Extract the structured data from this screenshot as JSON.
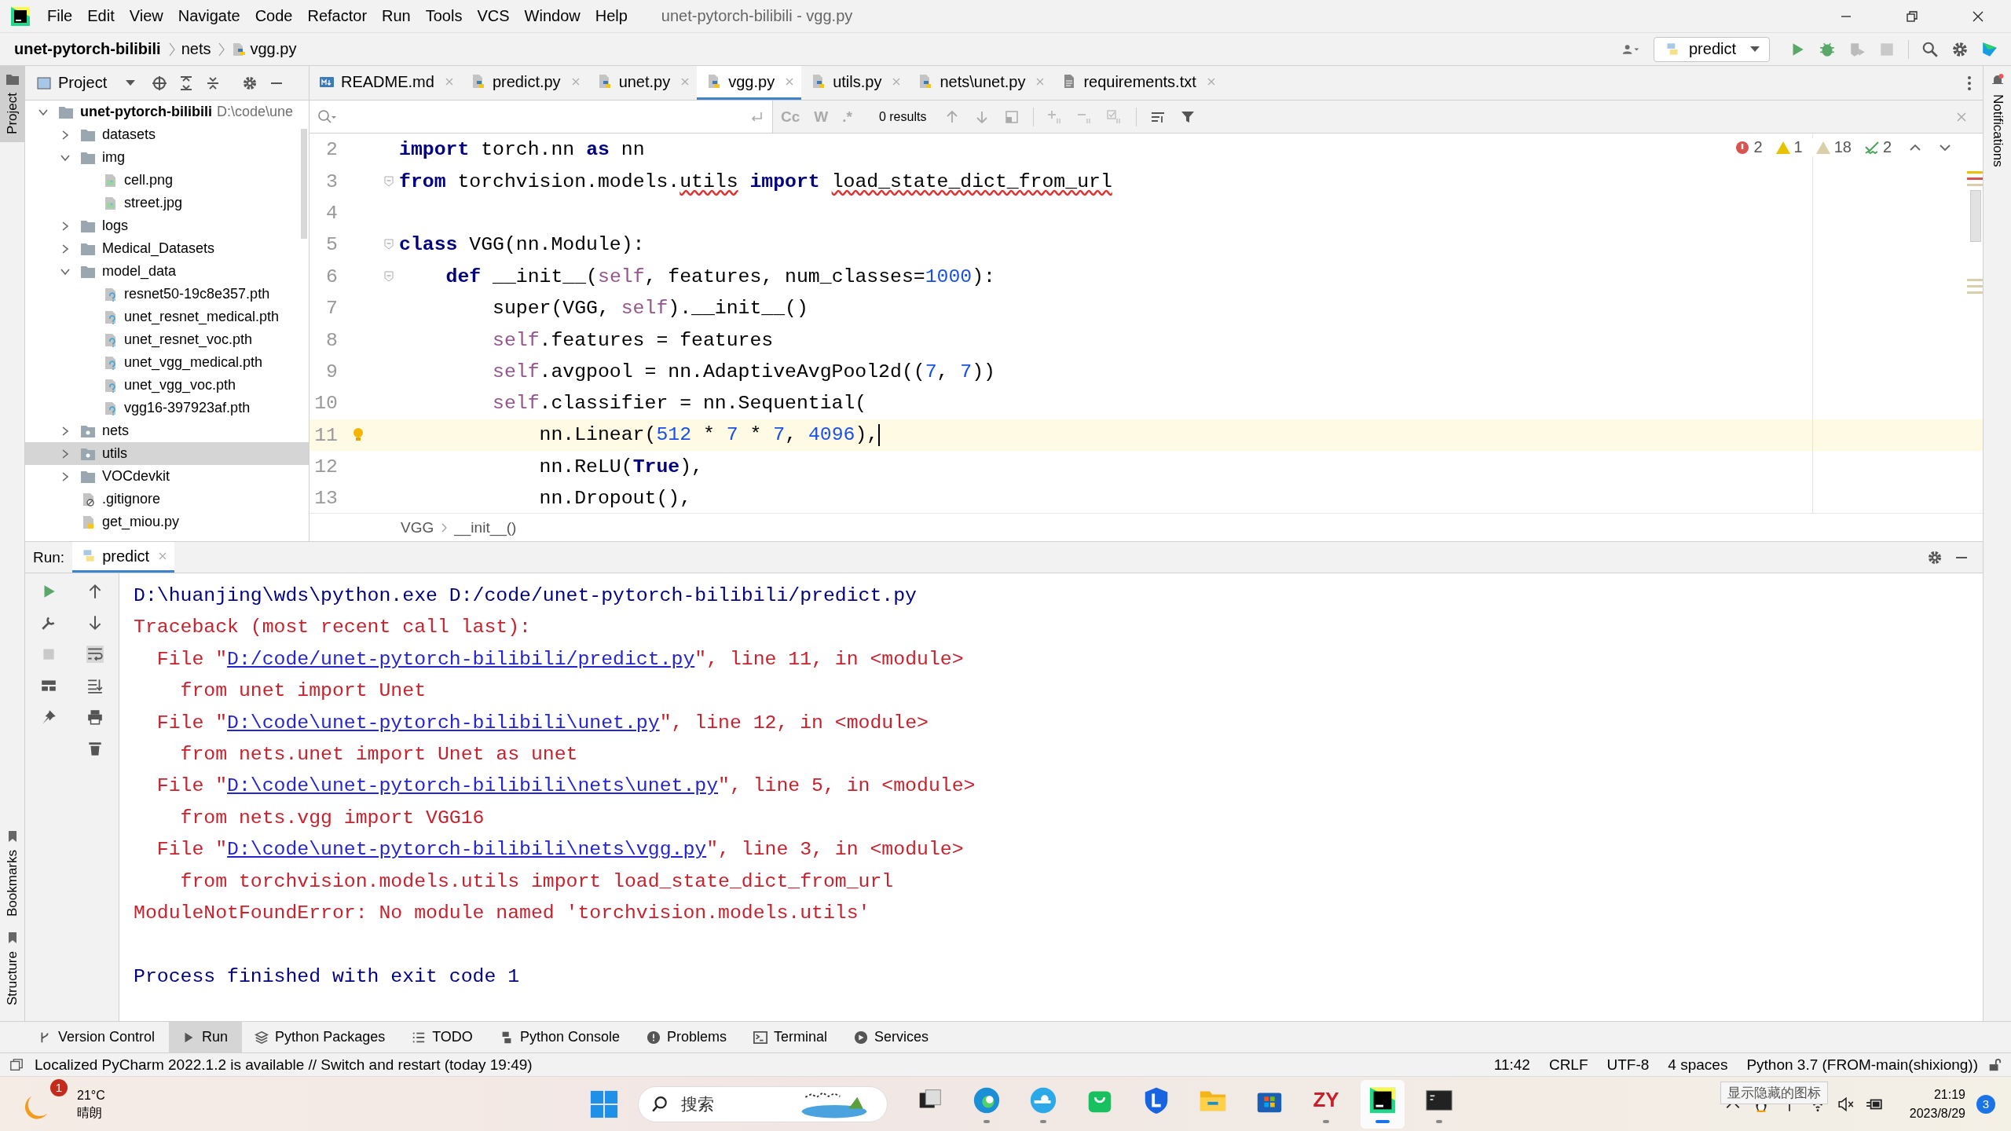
{
  "title_bar": {
    "menu": [
      "File",
      "Edit",
      "View",
      "Navigate",
      "Code",
      "Refactor",
      "Run",
      "Tools",
      "VCS",
      "Window",
      "Help"
    ],
    "title": "unet-pytorch-bilibili - vgg.py"
  },
  "nav_bar": {
    "breadcrumbs": [
      "unet-pytorch-bilibili",
      "nets",
      "vgg.py"
    ],
    "run_config": "predict"
  },
  "side_labels": {
    "left_top": "Project",
    "left_bottom": [
      "Bookmarks",
      "Structure"
    ],
    "right": "Notifications"
  },
  "project_panel": {
    "title": "Project",
    "tree": [
      {
        "name": "unet-pytorch-bilibili",
        "hint": "D:\\code\\une",
        "kind": "project",
        "expanded": true,
        "selected": false,
        "children": [
          {
            "name": "datasets",
            "kind": "folder",
            "expanded": false,
            "selected": false
          },
          {
            "name": "img",
            "kind": "folder",
            "expanded": true,
            "selected": false,
            "children": [
              {
                "name": "cell.png",
                "kind": "image",
                "selected": false
              },
              {
                "name": "street.jpg",
                "kind": "image",
                "selected": false
              }
            ]
          },
          {
            "name": "logs",
            "kind": "folder",
            "expanded": false,
            "selected": false
          },
          {
            "name": "Medical_Datasets",
            "kind": "folder",
            "expanded": false,
            "selected": false
          },
          {
            "name": "model_data",
            "kind": "folder",
            "expanded": true,
            "selected": false,
            "children": [
              {
                "name": "resnet50-19c8e357.pth",
                "kind": "unknown",
                "selected": false
              },
              {
                "name": "unet_resnet_medical.pth",
                "kind": "unknown",
                "selected": false
              },
              {
                "name": "unet_resnet_voc.pth",
                "kind": "unknown",
                "selected": false
              },
              {
                "name": "unet_vgg_medical.pth",
                "kind": "unknown",
                "selected": false
              },
              {
                "name": "unet_vgg_voc.pth",
                "kind": "unknown",
                "selected": false
              },
              {
                "name": "vgg16-397923af.pth",
                "kind": "unknown",
                "selected": false
              }
            ]
          },
          {
            "name": "nets",
            "kind": "package",
            "expanded": false,
            "selected": false
          },
          {
            "name": "utils",
            "kind": "package",
            "expanded": false,
            "selected": true
          },
          {
            "name": "VOCdevkit",
            "kind": "folder",
            "expanded": false,
            "selected": false
          },
          {
            "name": ".gitignore",
            "kind": "ignored",
            "selected": false
          },
          {
            "name": "get_miou.py",
            "kind": "python",
            "selected": false
          }
        ]
      }
    ]
  },
  "editor_tabs": [
    {
      "label": "README.md",
      "kind": "markdown",
      "selected": false
    },
    {
      "label": "predict.py",
      "kind": "python",
      "selected": false
    },
    {
      "label": "unet.py",
      "kind": "python",
      "selected": false
    },
    {
      "label": "vgg.py",
      "kind": "python",
      "selected": true
    },
    {
      "label": "utils.py",
      "kind": "python",
      "selected": false
    },
    {
      "label": "nets\\unet.py",
      "kind": "python",
      "selected": false
    },
    {
      "label": "requirements.txt",
      "kind": "text",
      "selected": false
    }
  ],
  "find_bar": {
    "options": [
      "Cc",
      "W",
      ".*"
    ],
    "results": "0 results"
  },
  "inspections": [
    {
      "kind": "error",
      "count": "2"
    },
    {
      "kind": "warning",
      "count": "1"
    },
    {
      "kind": "weak_warning",
      "count": "18"
    },
    {
      "kind": "typo",
      "count": "2"
    }
  ],
  "code_lines": [
    {
      "number": "2",
      "fold": false,
      "current": false,
      "tokens": [
        {
          "text": "import",
          "kind": "keyword"
        },
        {
          "text": " torch.nn ",
          "kind": "plain"
        },
        {
          "text": "as",
          "kind": "keyword"
        },
        {
          "text": " nn",
          "kind": "plain"
        }
      ]
    },
    {
      "number": "3",
      "fold": true,
      "current": false,
      "tokens": [
        {
          "text": "from",
          "kind": "keyword"
        },
        {
          "text": " torchvision.models.",
          "kind": "plain"
        },
        {
          "text": "utils",
          "kind": "unresolved"
        },
        {
          "text": " import",
          "kind": "keyword"
        },
        {
          "text": " load_state_dict_from_url",
          "kind": "unresolved"
        }
      ]
    },
    {
      "number": "4",
      "fold": false,
      "current": false
    },
    {
      "number": "5",
      "fold": true,
      "current": false,
      "tokens": [
        {
          "text": "class",
          "kind": "keyword"
        },
        {
          "text": " VGG(nn.Module):",
          "kind": "plain"
        }
      ]
    },
    {
      "number": "6",
      "fold": true,
      "current": false,
      "tokens": [
        {
          "text": "    def",
          "kind": "keyword"
        },
        {
          "text": " __init__(",
          "kind": "plain"
        },
        {
          "text": "self",
          "kind": "self"
        },
        {
          "text": ", features, num_classes=",
          "kind": "plain"
        },
        {
          "text": "1000",
          "kind": "number"
        },
        {
          "text": "):",
          "kind": "plain"
        }
      ]
    },
    {
      "number": "7",
      "fold": false,
      "current": false,
      "tokens": [
        {
          "text": "        super(VGG, ",
          "kind": "plain"
        },
        {
          "text": "self",
          "kind": "self"
        },
        {
          "text": ").__init__()",
          "kind": "plain"
        }
      ]
    },
    {
      "number": "8",
      "fold": false,
      "current": false,
      "tokens": [
        {
          "text": "        self",
          "kind": "self"
        },
        {
          "text": ".features = features",
          "kind": "plain"
        }
      ]
    },
    {
      "number": "9",
      "fold": false,
      "current": false,
      "tokens": [
        {
          "text": "        self",
          "kind": "self"
        },
        {
          "text": ".avgpool = nn.AdaptiveAvgPool2d((",
          "kind": "plain"
        },
        {
          "text": "7",
          "kind": "number"
        },
        {
          "text": ", ",
          "kind": "plain"
        },
        {
          "text": "7",
          "kind": "number"
        },
        {
          "text": "))",
          "kind": "plain"
        }
      ]
    },
    {
      "number": "10",
      "fold": false,
      "current": false,
      "tokens": [
        {
          "text": "        self",
          "kind": "self"
        },
        {
          "text": ".classifier = nn.Sequential(",
          "kind": "plain"
        }
      ]
    },
    {
      "number": "11",
      "fold": false,
      "current": true,
      "tokens": [
        {
          "text": "            nn.Linear(",
          "kind": "plain"
        },
        {
          "text": "512",
          "kind": "number"
        },
        {
          "text": " * ",
          "kind": "plain"
        },
        {
          "text": "7",
          "kind": "number"
        },
        {
          "text": " * ",
          "kind": "plain"
        },
        {
          "text": "7",
          "kind": "number"
        },
        {
          "text": ", ",
          "kind": "plain"
        },
        {
          "text": "4096",
          "kind": "number"
        },
        {
          "text": "),",
          "kind": "plain"
        }
      ]
    },
    {
      "number": "12",
      "fold": false,
      "current": false,
      "tokens": [
        {
          "text": "            nn.ReLU(",
          "kind": "plain"
        },
        {
          "text": "True",
          "kind": "keyword"
        },
        {
          "text": "),",
          "kind": "plain"
        }
      ]
    },
    {
      "number": "13",
      "fold": false,
      "current": false,
      "tokens": [
        {
          "text": "            nn.Dropout(),",
          "kind": "plain"
        }
      ]
    }
  ],
  "editor_breadcrumbs": [
    "VGG",
    "__init__()"
  ],
  "run_panel": {
    "label": "Run:",
    "tab": "predict",
    "output": [
      {
        "segments": [
          {
            "text": "D:\\huanjing\\wds\\python.exe D:/code/unet-pytorch-bilibili/predict.py",
            "kind": "command"
          }
        ]
      },
      {
        "segments": [
          {
            "text": "Traceback (most recent call last):",
            "kind": "error"
          }
        ]
      },
      {
        "segments": [
          {
            "text": "  File \"",
            "kind": "error"
          },
          {
            "text": "D:/code/unet-pytorch-bilibili/predict.py",
            "kind": "link"
          },
          {
            "text": "\", line 11, in <module>",
            "kind": "error"
          }
        ]
      },
      {
        "segments": [
          {
            "text": "    from unet import Unet",
            "kind": "error"
          }
        ]
      },
      {
        "segments": [
          {
            "text": "  File \"",
            "kind": "error"
          },
          {
            "text": "D:\\code\\unet-pytorch-bilibili\\unet.py",
            "kind": "link"
          },
          {
            "text": "\", line 12, in <module>",
            "kind": "error"
          }
        ]
      },
      {
        "segments": [
          {
            "text": "    from nets.unet import Unet as unet",
            "kind": "error"
          }
        ]
      },
      {
        "segments": [
          {
            "text": "  File \"",
            "kind": "error"
          },
          {
            "text": "D:\\code\\unet-pytorch-bilibili\\nets\\unet.py",
            "kind": "link"
          },
          {
            "text": "\", line 5, in <module>",
            "kind": "error"
          }
        ]
      },
      {
        "segments": [
          {
            "text": "    from nets.vgg import VGG16",
            "kind": "error"
          }
        ]
      },
      {
        "segments": [
          {
            "text": "  File \"",
            "kind": "error"
          },
          {
            "text": "D:\\code\\unet-pytorch-bilibili\\nets\\vgg.py",
            "kind": "link"
          },
          {
            "text": "\", line 3, in <module>",
            "kind": "error"
          }
        ]
      },
      {
        "segments": [
          {
            "text": "    from torchvision.models.utils import load_state_dict_from_url",
            "kind": "error"
          }
        ]
      },
      {
        "segments": [
          {
            "text": "ModuleNotFoundError: No module named 'torchvision.models.utils'",
            "kind": "error"
          }
        ]
      },
      {
        "blank_before": true,
        "segments": [
          {
            "text": "Process finished with exit code 1",
            "kind": "command"
          }
        ]
      }
    ]
  },
  "tool_tabs": [
    {
      "label": "Version Control",
      "selected": false
    },
    {
      "label": "Run",
      "selected": true
    },
    {
      "label": "Python Packages",
      "selected": false
    },
    {
      "label": "TODO",
      "selected": false
    },
    {
      "label": "Python Console",
      "selected": false
    },
    {
      "label": "Problems",
      "selected": false
    },
    {
      "label": "Terminal",
      "selected": false
    },
    {
      "label": "Services",
      "selected": false
    }
  ],
  "status_bar": {
    "message": "Localized PyCharm 2022.1.2 is available // Switch and restart (today 19:49)",
    "items": [
      "11:42",
      "CRLF",
      "UTF-8",
      "4 spaces",
      "Python 3.7 (FROM-main(shixiong))"
    ]
  },
  "taskbar": {
    "weather": {
      "badge": "1",
      "temperature": "21°C",
      "condition": "晴朗"
    },
    "search_placeholder": "搜索",
    "apps": [
      {
        "kind": "task_view",
        "running": false,
        "selected": false
      },
      {
        "kind": "edge",
        "running": true,
        "selected": false
      },
      {
        "kind": "edge_dev",
        "running": true,
        "selected": false
      },
      {
        "kind": "bag",
        "running": false,
        "selected": false
      },
      {
        "kind": "shield",
        "running": false,
        "selected": false
      },
      {
        "kind": "folder",
        "running": false,
        "selected": false
      },
      {
        "kind": "store",
        "running": false,
        "selected": false
      },
      {
        "kind": "zy",
        "label": "ZY",
        "running": true,
        "selected": false
      },
      {
        "kind": "pycharm",
        "running": true,
        "selected": true
      },
      {
        "kind": "terminal",
        "running": true,
        "selected": false
      }
    ],
    "tooltip": "显示隐藏的图标",
    "time": "21:19",
    "date": "2023/8/29",
    "notification_count": "3"
  }
}
